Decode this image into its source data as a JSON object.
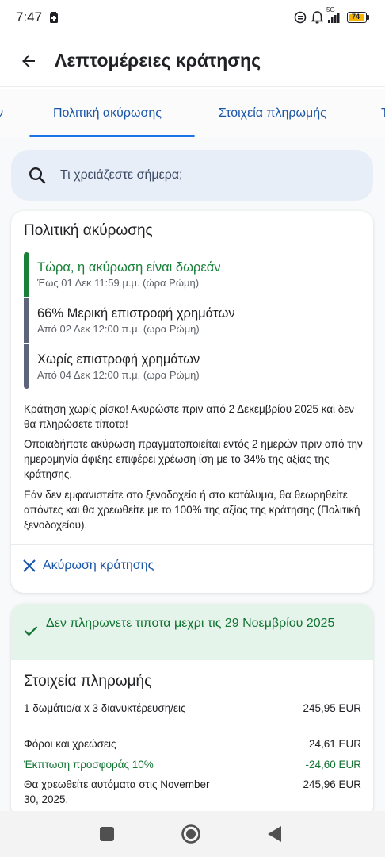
{
  "status_bar": {
    "time": "7:47",
    "network": "5G",
    "battery": "74",
    "icons": [
      "battery-saver-icon",
      "data-saver-icon",
      "alarm-icon",
      "signal-icon",
      "battery-icon"
    ]
  },
  "app_bar": {
    "title": "Λεπτομέρειες κράτησης",
    "back_icon": "arrow-back-icon"
  },
  "tabs": {
    "left_partial": "ν",
    "items": [
      "Πολιτική ακύρωσης",
      "Στοιχεία πληρωμής"
    ],
    "right_partial": "Τ",
    "active": "Πολιτική ακύρωσης"
  },
  "search": {
    "placeholder": "Τι χρειάζεστε σήμερα;",
    "icon": "search-icon"
  },
  "policy": {
    "title": "Πολιτική ακύρωσης",
    "timeline": [
      {
        "title": "Τώρα, η ακύρωση είναι δωρεάν",
        "subtitle": "Έως 01 Δεκ 11:59 μ.μ. (ώρα Ρώμη)",
        "color": "#188038"
      },
      {
        "title": "66% Μερική επιστροφή χρημάτων",
        "subtitle": "Από 02 Δεκ 12:00 π.μ. (ώρα Ρώμη)",
        "color": "#5f6578"
      },
      {
        "title": "Χωρίς επιστροφή χρημάτων",
        "subtitle": "Από 04 Δεκ 12:00 π.μ. (ώρα Ρώμη)",
        "color": "#5f6578"
      }
    ],
    "paragraphs": [
      "Κράτηση χωρίς ρίσκο! Ακυρώστε πριν από 2 Δεκεμβρίου 2025 και δεν θα πληρώσετε τίποτα!",
      "Οποιαδήποτε ακύρωση πραγματοποιείται εντός 2 ημερών πριν από την ημερομηνία άφιξης επιφέρει χρέωση ίση με το 34% της αξίας της κράτησης.",
      "Εάν δεν εμφανιστείτε στο ξενοδοχείο ή στο κατάλυμα, θα θεωρηθείτε απόντες και θα χρεωθείτε με το 100% της αξίας της κράτησης (Πολιτική ξενοδοχείου)."
    ],
    "cancel_label": "Ακύρωση κράτησης",
    "cancel_icon": "close-icon"
  },
  "payment": {
    "banner": "Δεν πληρωνετε τιποτα μεχρι τις 29 Νοεμβρίου 2025",
    "banner_icon": "check-icon",
    "title": "Στοιχεία πληρωμής",
    "rows": [
      {
        "label": "1 δωμάτιο/α x 3 διανυκτέρευση/εις",
        "value": "245,95 EUR",
        "highlight": false
      },
      {
        "label": "Φόροι και χρεώσεις",
        "value": "24,61 EUR",
        "highlight": false
      },
      {
        "label": "Έκπτωση προσφοράς 10%",
        "value": "-24,60 EUR",
        "highlight": true
      },
      {
        "label": "Θα χρεωθείτε αυτόματα στις November 30, 2025.",
        "value": "245,96 EUR",
        "highlight": false
      }
    ]
  },
  "nav_bar": {
    "icons": [
      "recents-square-icon",
      "home-circle-icon",
      "back-triangle-icon"
    ]
  },
  "colors": {
    "accent": "#1a73e8",
    "link": "#1a56a8",
    "success": "#188038",
    "success_bg": "#e5f4ea",
    "search_bg": "#e8eef8"
  }
}
